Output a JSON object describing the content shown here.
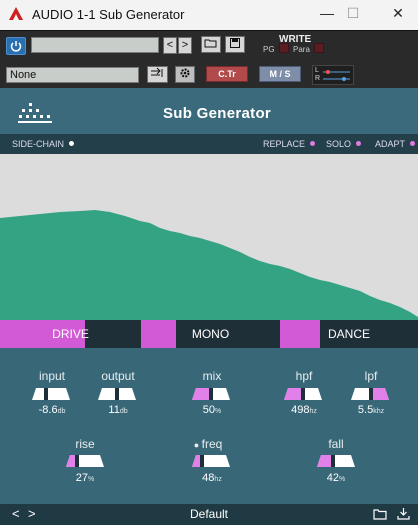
{
  "window": {
    "title": "AUDIO 1-1 Sub Generator",
    "minimize": "—",
    "maximize": "☐",
    "close": "✕"
  },
  "host": {
    "arrow_left": "<",
    "arrow_right": ">",
    "write_label": "WRITE",
    "pg_label": "PG",
    "para_label": "Para",
    "sidechain_field": "None",
    "ctr_label": "C.Tr",
    "ms_label": "M / S",
    "l_label": "L",
    "r_label": "R"
  },
  "plugin": {
    "title": "Sub Generator",
    "options": {
      "sidechain": "SIDE-CHAIN",
      "replace": "REPLACE",
      "solo": "SOLO",
      "adapt": "ADAPT"
    },
    "modes": {
      "drive": "DRIVE",
      "mono": "MONO",
      "dance": "DANCE"
    },
    "controls": {
      "input": {
        "label": "input",
        "value": "-8.6",
        "unit": "db"
      },
      "output": {
        "label": "output",
        "value": "11",
        "unit": "db"
      },
      "mix": {
        "label": "mix",
        "value": "50",
        "unit": "%"
      },
      "hpf": {
        "label": "hpf",
        "value": "498",
        "unit": "hz"
      },
      "lpf": {
        "label": "lpf",
        "value": "5.5",
        "unit": "khz"
      },
      "rise": {
        "label": "rise",
        "value": "27",
        "unit": "%"
      },
      "freq": {
        "label": "freq",
        "value": "48",
        "unit": "hz"
      },
      "fall": {
        "label": "fall",
        "value": "42",
        "unit": "%"
      }
    },
    "footer": {
      "prev": "<",
      "next": ">",
      "preset": "Default"
    }
  },
  "colors": {
    "accent_pink": "#d25ad6",
    "spectrum_green": "#34a383",
    "panel_teal": "#386778"
  }
}
